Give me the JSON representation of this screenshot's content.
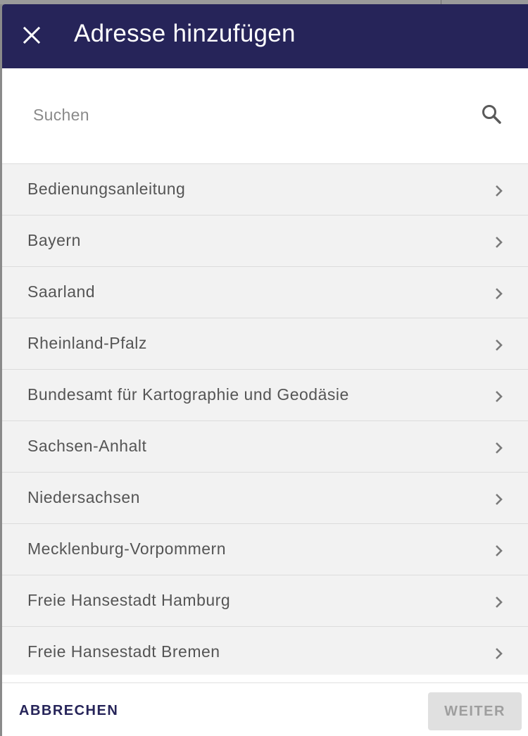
{
  "dialog": {
    "title": "Adresse hinzufügen",
    "close_icon": "close-icon"
  },
  "search": {
    "placeholder": "Suchen",
    "value": "",
    "icon": "search-icon"
  },
  "list": {
    "items": [
      {
        "label": "Bedienungsanleitung"
      },
      {
        "label": "Bayern"
      },
      {
        "label": "Saarland"
      },
      {
        "label": "Rheinland-Pfalz"
      },
      {
        "label": "Bundesamt für Kartographie und Geodäsie"
      },
      {
        "label": "Sachsen-Anhalt"
      },
      {
        "label": "Niedersachsen"
      },
      {
        "label": "Mecklenburg-Vorpommern"
      },
      {
        "label": "Freie Hansestadt Hamburg"
      },
      {
        "label": "Freie Hansestadt Bremen"
      }
    ],
    "item_icon": "chevron-right-icon"
  },
  "footer": {
    "cancel_label": "ABBRECHEN",
    "next_label": "WEITER"
  },
  "colors": {
    "header_bg": "#262459",
    "list_bg": "#f2f2f2",
    "cancel_text": "#262459",
    "disabled_button_bg": "#e0e0e0"
  }
}
